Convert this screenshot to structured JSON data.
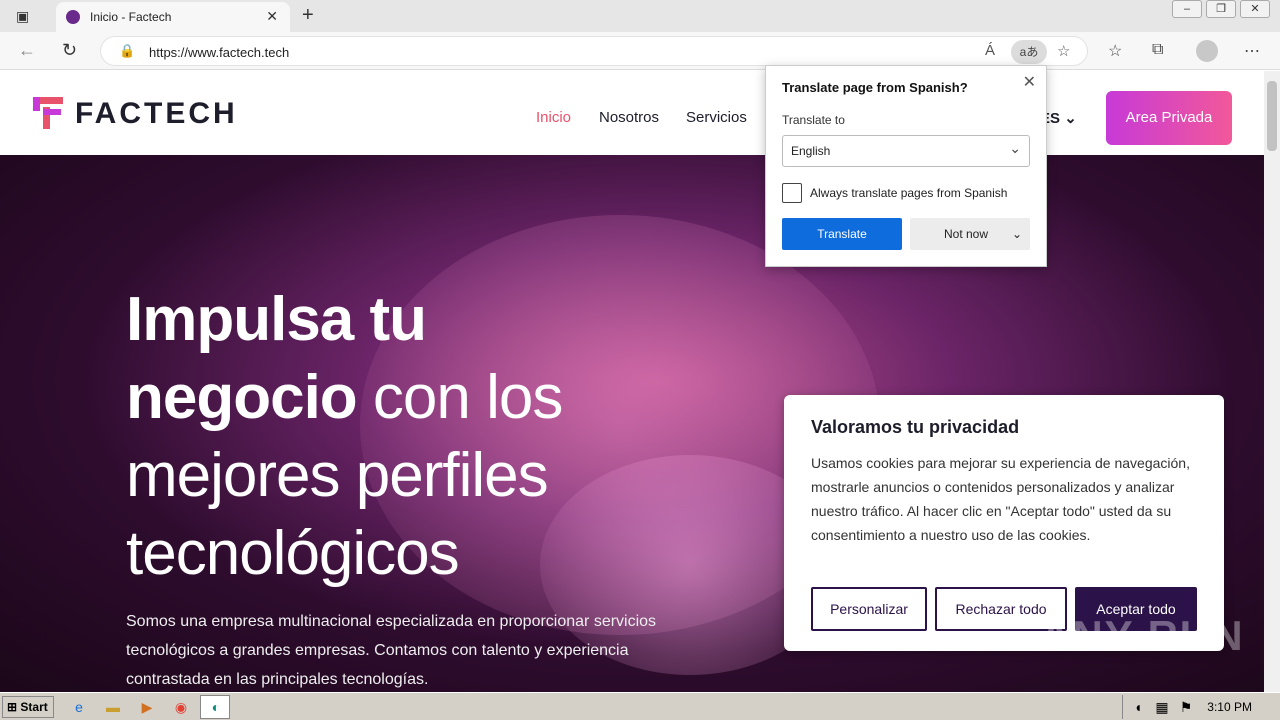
{
  "browser": {
    "tab_title": "Inicio - Factech",
    "url": "https://www.factech.tech",
    "translate_badge": "aあ",
    "read_aloud": "Á"
  },
  "site": {
    "logo": "FACTECH",
    "nav": [
      "Inicio",
      "Nosotros",
      "Servicios"
    ],
    "lang": "ES",
    "area_privada": "Area Privada",
    "hero_title_l1": "Impulsa tu",
    "hero_title_l2a": "negocio",
    "hero_title_l2b": "con los",
    "hero_title_l3": "mejores perfiles",
    "hero_title_l4": "tecnológicos",
    "hero_sub": "Somos una empresa multinacional especializada en proporcionar servicios tecnológicos a grandes empresas. Contamos con talento y experiencia contrastada en las principales tecnologías."
  },
  "cookie": {
    "title": "Valoramos tu privacidad",
    "text": "Usamos cookies para mejorar su experiencia de navegación, mostrarle anuncios o contenidos personalizados y analizar nuestro tráfico. Al hacer clic en \"Aceptar todo\" usted da su consentimiento a nuestro uso de las cookies.",
    "personalizar": "Personalizar",
    "rechazar": "Rechazar todo",
    "aceptar": "Aceptar todo"
  },
  "translate": {
    "title": "Translate page from Spanish?",
    "translate_to": "Translate to",
    "language": "English",
    "always": "Always translate pages from Spanish",
    "translate_btn": "Translate",
    "not_now": "Not now"
  },
  "taskbar": {
    "start": "Start",
    "clock": "3:10 PM"
  },
  "watermark": "ANY RUN",
  "colors": {
    "accent_pink": "#e8526b",
    "translate_blue": "#0f6cdd",
    "cookie_purple": "#2b1248"
  }
}
